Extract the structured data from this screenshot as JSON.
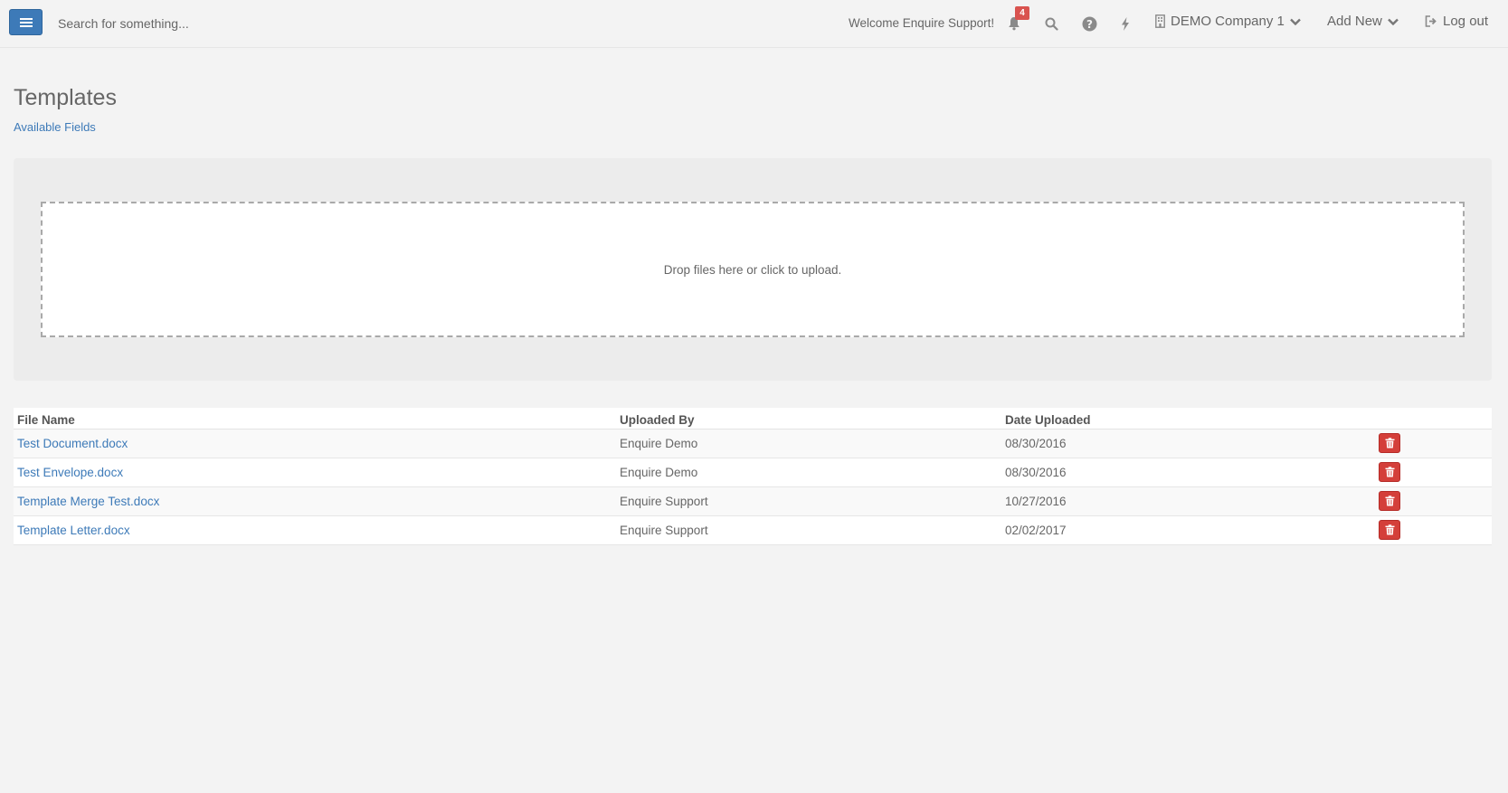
{
  "navbar": {
    "search_placeholder": "Search for something...",
    "welcome_text": "Welcome Enquire Support!",
    "notification_count": "4",
    "company_label": "DEMO Company 1",
    "add_new_label": "Add New",
    "logout_label": "Log out",
    "icons": [
      "menu-icon",
      "bell-icon",
      "search-icon",
      "help-icon",
      "bolt-icon",
      "building-icon",
      "chevron-down-icon",
      "logout-icon"
    ]
  },
  "page": {
    "title": "Templates",
    "fields_link": "Available Fields"
  },
  "dropzone": {
    "message": "Drop files here or click to upload."
  },
  "table": {
    "headers": {
      "file_name": "File Name",
      "uploaded_by": "Uploaded By",
      "date_uploaded": "Date Uploaded"
    },
    "rows": [
      {
        "file_name": "Test Document.docx",
        "uploaded_by": "Enquire Demo",
        "date_uploaded": "08/30/2016"
      },
      {
        "file_name": "Test Envelope.docx",
        "uploaded_by": "Enquire Demo",
        "date_uploaded": "08/30/2016"
      },
      {
        "file_name": "Template Merge Test.docx",
        "uploaded_by": "Enquire Support",
        "date_uploaded": "10/27/2016"
      },
      {
        "file_name": "Template Letter.docx",
        "uploaded_by": "Enquire Support",
        "date_uploaded": "02/02/2017"
      }
    ]
  },
  "colors": {
    "primary": "#3d7ab8",
    "danger": "#d43f3a",
    "badge": "#d9534f",
    "background": "#f3f3f3"
  }
}
